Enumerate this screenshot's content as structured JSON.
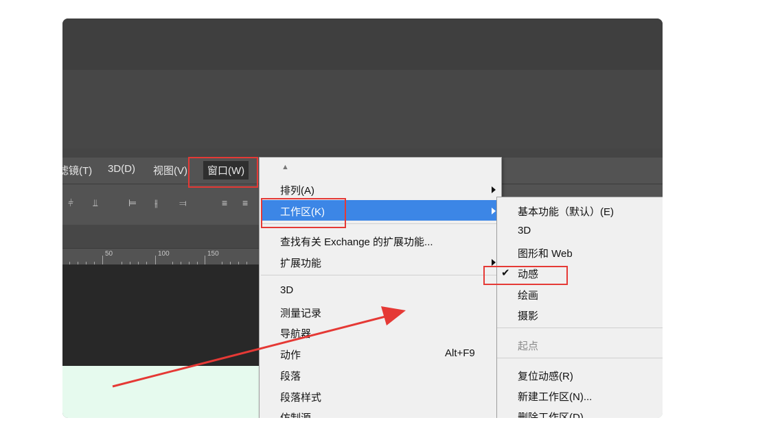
{
  "menubar": {
    "items": [
      "滤镜(T)",
      "3D(D)",
      "视图(V)",
      "窗口(W)"
    ]
  },
  "ruler": {
    "labels": [
      "50",
      "100",
      "150"
    ]
  },
  "window_menu": {
    "scroll_up": "▲",
    "arrange": "排列(A)",
    "workspace": "工作区(K)",
    "find_exchange": "查找有关 Exchange 的扩展功能...",
    "extensions": "扩展功能",
    "items": [
      "3D",
      "测量记录",
      "导航器",
      "动作",
      "段落",
      "段落样式",
      "仿制源"
    ],
    "action_shortcut": "Alt+F9"
  },
  "workspace_submenu": {
    "essentials": "基本功能（默认）(E)",
    "three_d": "3D",
    "graphics_web": "图形和 Web",
    "motion": "动感",
    "motion_check": "✔",
    "painting": "绘画",
    "photography": "摄影",
    "start": "起点",
    "reset": "复位动感(R)",
    "new_workspace": "新建工作区(N)...",
    "delete_workspace": "删除工作区(D)..."
  },
  "colors": {
    "highlight": "#3c86e6",
    "annotation_red": "#e53935",
    "canvas_mint": "#e6faee"
  }
}
